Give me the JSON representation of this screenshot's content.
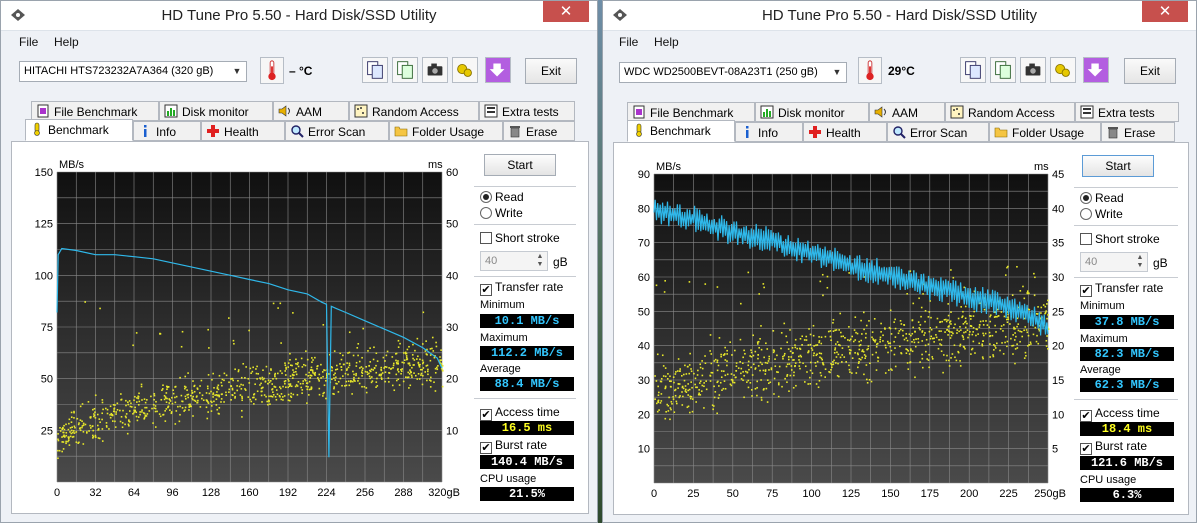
{
  "windows": [
    {
      "title": "HD Tune Pro 5.50 - Hard Disk/SSD Utility",
      "menu": [
        "File",
        "Help"
      ],
      "drive": "HITACHI HTS723232A7A364 (320 gB)",
      "temperature": "– °C",
      "exit_label": "Exit",
      "tabs_top": [
        "File Benchmark",
        "Disk monitor",
        "AAM",
        "Random Access",
        "Extra tests"
      ],
      "tabs_bottom": [
        "Benchmark",
        "Info",
        "Health",
        "Error Scan",
        "Folder Usage",
        "Erase"
      ],
      "active_tab": "Benchmark",
      "start_label": "Start",
      "read_label": "Read",
      "write_label": "Write",
      "mode": "read",
      "short_stroke_label": "Short stroke",
      "short_stroke_checked": false,
      "short_stroke_value": "40",
      "short_stroke_unit": "gB",
      "transfer_rate_label": "Transfer rate",
      "transfer_rate_checked": true,
      "minimum_label": "Minimum",
      "minimum_value": "10.1 MB/s",
      "maximum_label": "Maximum",
      "maximum_value": "112.2 MB/s",
      "average_label": "Average",
      "average_value": "88.4 MB/s",
      "access_time_label": "Access time",
      "access_time_checked": true,
      "access_time_value": "16.5 ms",
      "burst_rate_label": "Burst rate",
      "burst_rate_checked": true,
      "burst_rate_value": "140.4 MB/s",
      "cpu_usage_label": "CPU usage",
      "cpu_usage_value": "21.5%"
    },
    {
      "title": "HD Tune Pro 5.50 - Hard Disk/SSD Utility",
      "menu": [
        "File",
        "Help"
      ],
      "drive": "WDC WD2500BEVT-08A23T1 (250 gB)",
      "temperature": "29°C",
      "exit_label": "Exit",
      "tabs_top": [
        "File Benchmark",
        "Disk monitor",
        "AAM",
        "Random Access",
        "Extra tests"
      ],
      "tabs_bottom": [
        "Benchmark",
        "Info",
        "Health",
        "Error Scan",
        "Folder Usage",
        "Erase"
      ],
      "active_tab": "Benchmark",
      "start_label": "Start",
      "read_label": "Read",
      "write_label": "Write",
      "mode": "read",
      "short_stroke_label": "Short stroke",
      "short_stroke_checked": false,
      "short_stroke_value": "40",
      "short_stroke_unit": "gB",
      "transfer_rate_label": "Transfer rate",
      "transfer_rate_checked": true,
      "minimum_label": "Minimum",
      "minimum_value": "37.8 MB/s",
      "maximum_label": "Maximum",
      "maximum_value": "82.3 MB/s",
      "average_label": "Average",
      "average_value": "62.3 MB/s",
      "access_time_label": "Access time",
      "access_time_checked": true,
      "access_time_value": "18.4 ms",
      "burst_rate_label": "Burst rate",
      "burst_rate_checked": true,
      "burst_rate_value": "121.6 MB/s",
      "cpu_usage_label": "CPU usage",
      "cpu_usage_value": "6.3%"
    }
  ],
  "colors": {
    "transfer_line": "#2fb8ea",
    "access_points": "#e8e82a",
    "plot_bg_top": "#101010",
    "plot_bg_bottom": "#4a4a4a",
    "grid": "#8a8a8a"
  },
  "icons": {
    "toolbar": [
      "copy-text-icon",
      "copy-screenshot-icon",
      "camera-icon",
      "options-icon",
      "save-icon"
    ],
    "tabs_top": [
      "file-benchmark-icon",
      "disk-monitor-icon",
      "speaker-icon",
      "random-access-icon",
      "extra-tests-icon"
    ],
    "tabs_bottom": [
      "benchmark-icon",
      "info-icon",
      "health-icon",
      "error-scan-icon",
      "folder-icon",
      "erase-icon"
    ]
  },
  "chart_data": [
    {
      "type": "line",
      "ylabel_left": "MB/s",
      "ylabel_right": "ms",
      "x_unit": "gB",
      "xlim": [
        0,
        320
      ],
      "ylim_left": [
        0,
        150
      ],
      "ylim_right": [
        0,
        60
      ],
      "x_ticks": [
        "0",
        "32",
        "64",
        "96",
        "128",
        "160",
        "192",
        "224",
        "256",
        "288",
        "320gB"
      ],
      "y_ticks_left": [
        "150",
        "125",
        "100",
        "75",
        "50",
        "25"
      ],
      "y_ticks_right": [
        "60",
        "50",
        "40",
        "30",
        "20",
        "10"
      ],
      "grid": true,
      "series": [
        {
          "kind": "transfer_rate_mbs",
          "x": [
            0,
            1,
            4,
            16,
            32,
            48,
            64,
            80,
            96,
            112,
            128,
            144,
            160,
            176,
            192,
            208,
            220,
            224,
            226,
            228,
            232,
            240,
            256,
            272,
            288,
            304,
            316,
            320
          ],
          "y": [
            82,
            110,
            113,
            112,
            110,
            110,
            109,
            108,
            106,
            104,
            102,
            100,
            98,
            96,
            93,
            91,
            87,
            86,
            12,
            85,
            84,
            82,
            78,
            74,
            70,
            65,
            60,
            55
          ]
        },
        {
          "kind": "access_time_ms",
          "trend_x": [
            0,
            32,
            64,
            96,
            128,
            160,
            192,
            224,
            256,
            288,
            320
          ],
          "trend_y": [
            9,
            12,
            14.5,
            16,
            17,
            18.5,
            19.5,
            20.5,
            21.5,
            22.5,
            23
          ],
          "spread_ms": 4,
          "outlier_range_ms": [
            25,
            36
          ]
        }
      ]
    },
    {
      "type": "line",
      "ylabel_left": "MB/s",
      "ylabel_right": "ms",
      "x_unit": "gB",
      "xlim": [
        0,
        250
      ],
      "ylim_left": [
        0,
        90
      ],
      "ylim_right": [
        0,
        45
      ],
      "x_ticks": [
        "0",
        "25",
        "50",
        "75",
        "100",
        "125",
        "150",
        "175",
        "200",
        "225",
        "250gB"
      ],
      "y_ticks_left": [
        "90",
        "80",
        "70",
        "60",
        "50",
        "40",
        "30",
        "20",
        "10"
      ],
      "y_ticks_right": [
        "45",
        "40",
        "35",
        "30",
        "25",
        "20",
        "15",
        "10",
        "5"
      ],
      "grid": true,
      "series": [
        {
          "kind": "transfer_rate_mbs",
          "x": [
            0,
            12,
            25,
            37,
            50,
            62,
            75,
            87,
            100,
            112,
            125,
            137,
            150,
            162,
            175,
            187,
            200,
            212,
            225,
            237,
            250
          ],
          "y": [
            80,
            78,
            77,
            75,
            73,
            72,
            71,
            68,
            67,
            66,
            63,
            62,
            61,
            59,
            57,
            56,
            54,
            53,
            51,
            49,
            45
          ],
          "jitter_mbs": 3
        },
        {
          "kind": "access_time_ms",
          "trend_x": [
            0,
            25,
            50,
            75,
            100,
            125,
            150,
            175,
            200,
            225,
            250
          ],
          "trend_y": [
            13,
            15,
            16.5,
            17.5,
            18.5,
            19.5,
            20.5,
            21.5,
            22.5,
            23,
            23.5
          ],
          "spread_ms": 4.5,
          "outlier_range_ms": [
            26,
            32
          ]
        }
      ]
    }
  ]
}
